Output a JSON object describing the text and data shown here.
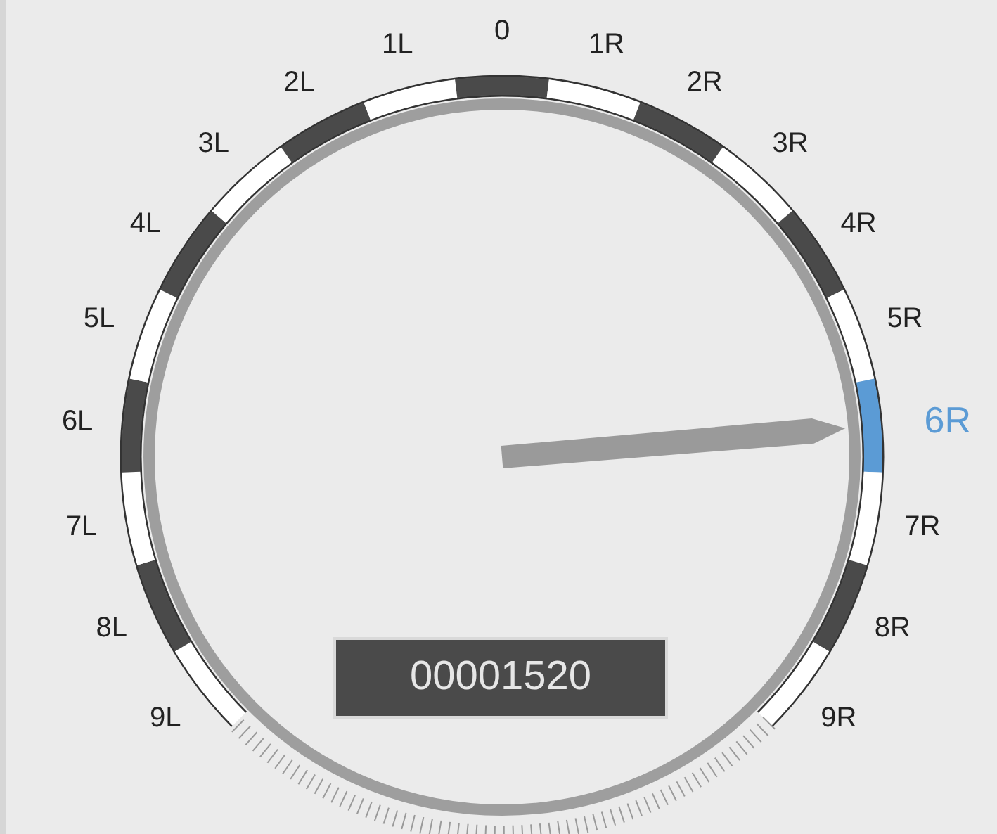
{
  "dial": {
    "marks": [
      {
        "label": "9L",
        "selected": false
      },
      {
        "label": "8L",
        "selected": false
      },
      {
        "label": "7L",
        "selected": false
      },
      {
        "label": "6L",
        "selected": false
      },
      {
        "label": "5L",
        "selected": false
      },
      {
        "label": "4L",
        "selected": false
      },
      {
        "label": "3L",
        "selected": false
      },
      {
        "label": "2L",
        "selected": false
      },
      {
        "label": "1L",
        "selected": false
      },
      {
        "label": "0",
        "selected": false
      },
      {
        "label": "1R",
        "selected": false
      },
      {
        "label": "2R",
        "selected": false
      },
      {
        "label": "3R",
        "selected": false
      },
      {
        "label": "4R",
        "selected": false
      },
      {
        "label": "5R",
        "selected": false
      },
      {
        "label": "6R",
        "selected": true
      },
      {
        "label": "7R",
        "selected": false
      },
      {
        "label": "8R",
        "selected": false
      },
      {
        "label": "9R",
        "selected": false
      }
    ],
    "counter": "00001520"
  }
}
